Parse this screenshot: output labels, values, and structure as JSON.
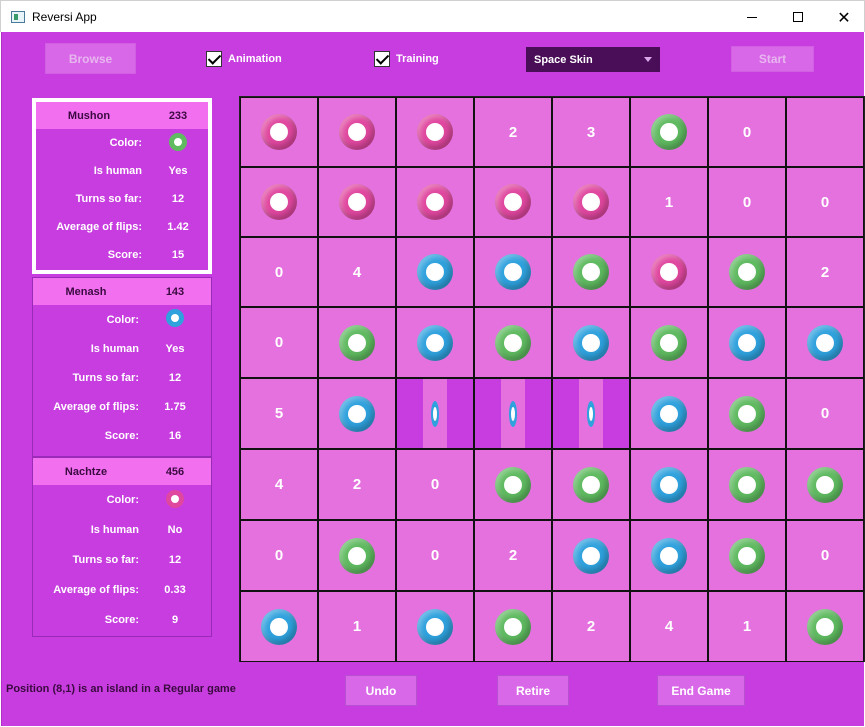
{
  "window": {
    "title": "Reversi App"
  },
  "toolbar": {
    "browse_label": "Browse",
    "animation_label": "Animation",
    "animation_checked": true,
    "training_label": "Training",
    "training_checked": true,
    "skin_value": "Space Skin",
    "start_label": "Start"
  },
  "colors": {
    "pink": "#e0479f",
    "green": "#5fba60",
    "blue": "#2fa1dd",
    "cell": "#e571df",
    "background": "#c83ddf"
  },
  "players": [
    {
      "name": "Mushon",
      "id": "233",
      "color_label": "Color:",
      "color": "green",
      "human_label": "Is human",
      "human": "Yes",
      "turns_label": "Turns so far:",
      "turns": "12",
      "avg_label": "Average of flips:",
      "avg": "1.42",
      "score_label": "Score:",
      "score": "15",
      "active": true
    },
    {
      "name": "Menash",
      "id": "143",
      "color_label": "Color:",
      "color": "blue",
      "human_label": "Is human",
      "human": "Yes",
      "turns_label": "Turns so far:",
      "turns": "12",
      "avg_label": "Average of flips:",
      "avg": "1.75",
      "score_label": "Score:",
      "score": "16",
      "active": false
    },
    {
      "name": "Nachtze",
      "id": "456",
      "color_label": "Color:",
      "color": "pink",
      "human_label": "Is human",
      "human": "No",
      "turns_label": "Turns so far:",
      "turns": "12",
      "avg_label": "Average of flips:",
      "avg": "0.33",
      "score_label": "Score:",
      "score": "9",
      "active": false
    }
  ],
  "board": [
    [
      "P",
      "P",
      "P",
      "2",
      "3",
      "G",
      "0",
      ""
    ],
    [
      "P",
      "P",
      "P",
      "P",
      "P",
      "1",
      "0",
      "0"
    ],
    [
      "0",
      "4",
      "B",
      "B",
      "G",
      "P",
      "G",
      "2"
    ],
    [
      "0",
      "G",
      "B",
      "G",
      "B",
      "G",
      "B",
      "B"
    ],
    [
      "5",
      "B",
      "FB",
      "FB",
      "FB",
      "B",
      "G",
      "0"
    ],
    [
      "4",
      "2",
      "0",
      "G",
      "G",
      "B",
      "G",
      "G"
    ],
    [
      "0",
      "G",
      "0",
      "2",
      "B",
      "B",
      "G",
      "0"
    ],
    [
      "B",
      "1",
      "B",
      "G",
      "2",
      "4",
      "1",
      "G"
    ]
  ],
  "status_text": "Position (8,1) is an island in a Regular game",
  "buttons": {
    "undo": "Undo",
    "retire": "Retire",
    "end_game": "End Game"
  }
}
